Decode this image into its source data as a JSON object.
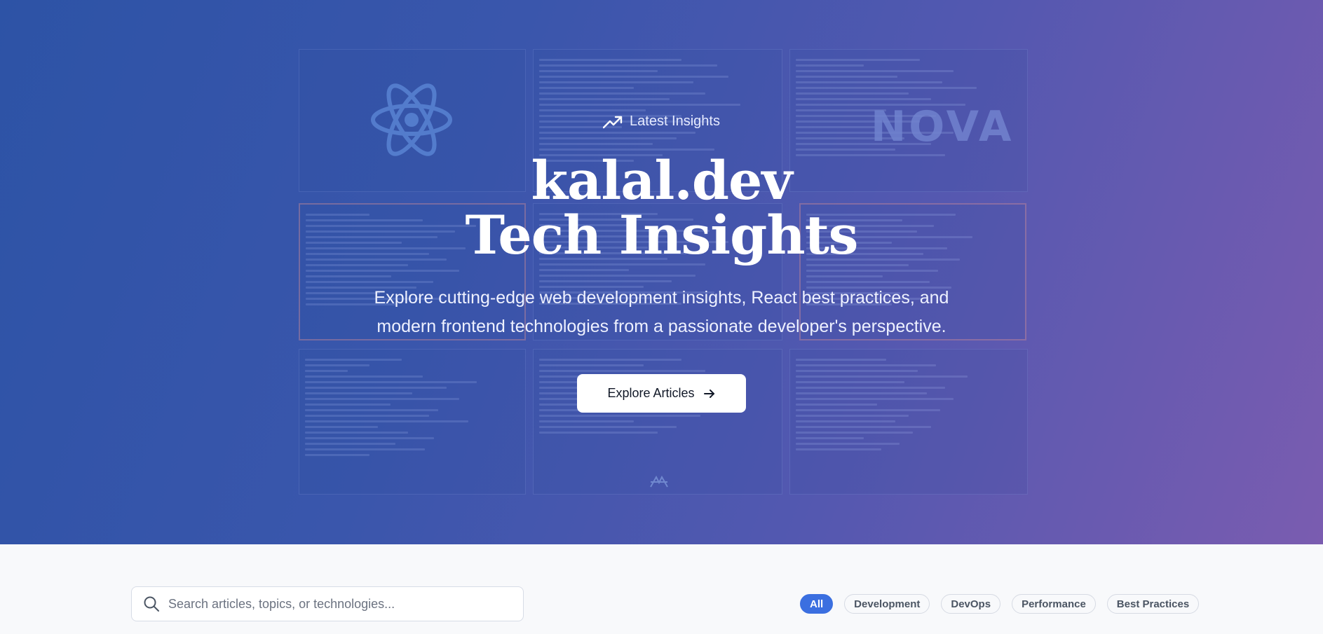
{
  "hero": {
    "eyebrow_icon": "trending-up-icon",
    "eyebrow": "Latest Insights",
    "title_line1": "kalal.dev",
    "title_line2": "Tech Insights",
    "subtitle": "Explore cutting-edge web development insights, React best practices, and modern frontend technologies from a passionate developer's perspective.",
    "cta_label": "Explore Articles",
    "cta_icon": "arrow-right-icon",
    "background_logo": "NOVA"
  },
  "search": {
    "icon": "search-icon",
    "placeholder": "Search articles, topics, or technologies..."
  },
  "filters": {
    "items": [
      {
        "label": "All",
        "active": true
      },
      {
        "label": "Development",
        "active": false
      },
      {
        "label": "DevOps",
        "active": false
      },
      {
        "label": "Performance",
        "active": false
      },
      {
        "label": "Best Practices",
        "active": false
      }
    ]
  },
  "colors": {
    "hero_gradient_start": "#2d53a6",
    "hero_gradient_end": "#7a5cb0",
    "accent": "#3b6fe0",
    "page_background": "#f8f9fb"
  }
}
